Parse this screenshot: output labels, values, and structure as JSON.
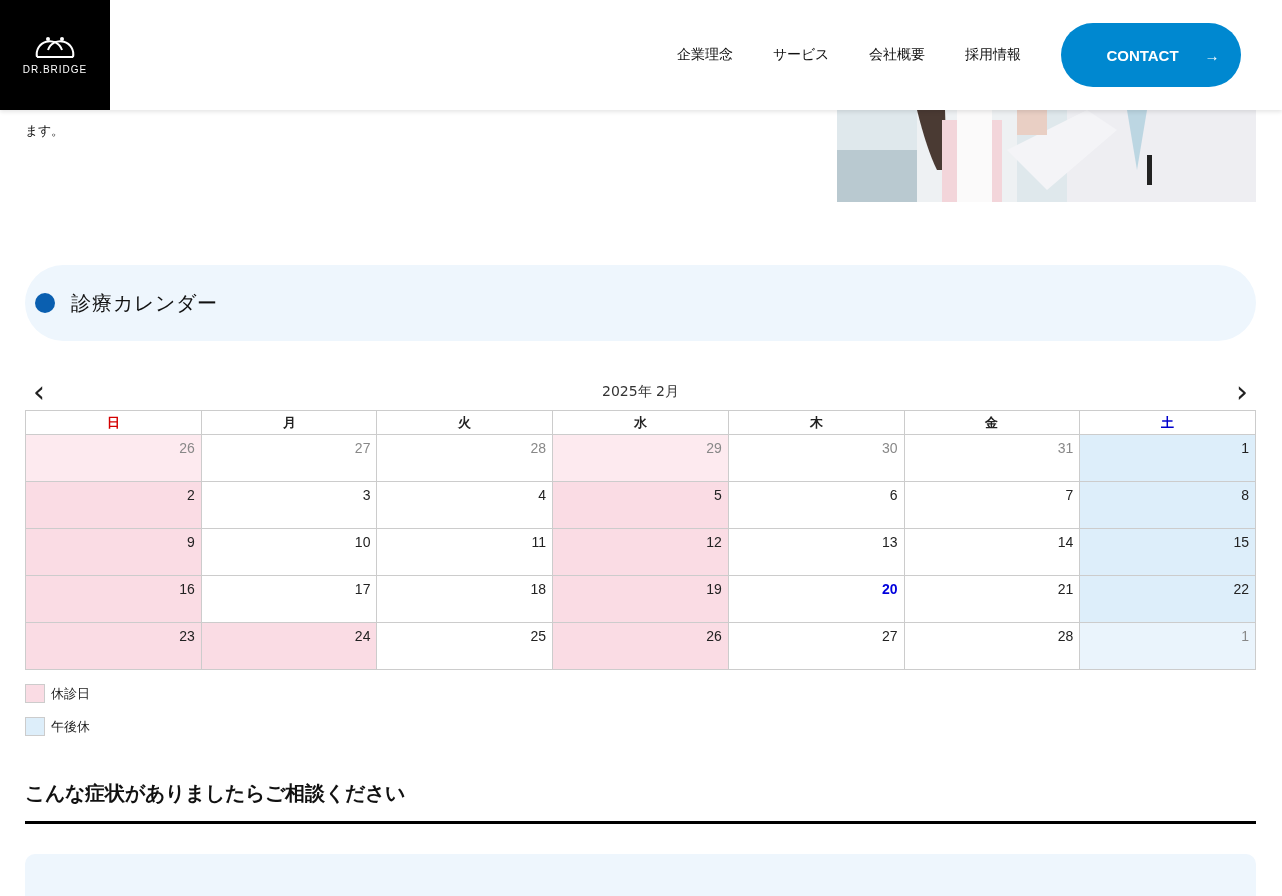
{
  "header": {
    "logo": "DR.BRIDGE",
    "nav": [
      "企業理念",
      "サービス",
      "会社概要",
      "採用情報"
    ],
    "contact": "CONTACT",
    "contact_arrow": "→"
  },
  "intro": {
    "text": "ます。"
  },
  "calendar_section": {
    "title": "診療カレンダー",
    "prev": "‹",
    "month": "2025年 2月",
    "next": "›",
    "weekdays": [
      {
        "label": "日",
        "kind": "sun"
      },
      {
        "label": "月",
        "kind": "day"
      },
      {
        "label": "火",
        "kind": "day"
      },
      {
        "label": "水",
        "kind": "day"
      },
      {
        "label": "木",
        "kind": "day"
      },
      {
        "label": "金",
        "kind": "day"
      },
      {
        "label": "土",
        "kind": "sat"
      }
    ],
    "weeks": [
      [
        {
          "day": "26",
          "kind": "closed",
          "outside": true,
          "today": false
        },
        {
          "day": "27",
          "kind": "open",
          "outside": true,
          "today": false
        },
        {
          "day": "28",
          "kind": "open",
          "outside": true,
          "today": false
        },
        {
          "day": "29",
          "kind": "closed",
          "outside": true,
          "today": false
        },
        {
          "day": "30",
          "kind": "open",
          "outside": true,
          "today": false
        },
        {
          "day": "31",
          "kind": "open",
          "outside": true,
          "today": false
        },
        {
          "day": "1",
          "kind": "half",
          "outside": false,
          "today": false
        }
      ],
      [
        {
          "day": "2",
          "kind": "closed",
          "outside": false,
          "today": false
        },
        {
          "day": "3",
          "kind": "open",
          "outside": false,
          "today": false
        },
        {
          "day": "4",
          "kind": "open",
          "outside": false,
          "today": false
        },
        {
          "day": "5",
          "kind": "closed",
          "outside": false,
          "today": false
        },
        {
          "day": "6",
          "kind": "open",
          "outside": false,
          "today": false
        },
        {
          "day": "7",
          "kind": "open",
          "outside": false,
          "today": false
        },
        {
          "day": "8",
          "kind": "half",
          "outside": false,
          "today": false
        }
      ],
      [
        {
          "day": "9",
          "kind": "closed",
          "outside": false,
          "today": false
        },
        {
          "day": "10",
          "kind": "open",
          "outside": false,
          "today": false
        },
        {
          "day": "11",
          "kind": "open",
          "outside": false,
          "today": false
        },
        {
          "day": "12",
          "kind": "closed",
          "outside": false,
          "today": false
        },
        {
          "day": "13",
          "kind": "open",
          "outside": false,
          "today": false
        },
        {
          "day": "14",
          "kind": "open",
          "outside": false,
          "today": false
        },
        {
          "day": "15",
          "kind": "half",
          "outside": false,
          "today": false
        }
      ],
      [
        {
          "day": "16",
          "kind": "closed",
          "outside": false,
          "today": false
        },
        {
          "day": "17",
          "kind": "open",
          "outside": false,
          "today": false
        },
        {
          "day": "18",
          "kind": "open",
          "outside": false,
          "today": false
        },
        {
          "day": "19",
          "kind": "closed",
          "outside": false,
          "today": false
        },
        {
          "day": "20",
          "kind": "open",
          "outside": false,
          "today": true
        },
        {
          "day": "21",
          "kind": "open",
          "outside": false,
          "today": false
        },
        {
          "day": "22",
          "kind": "half",
          "outside": false,
          "today": false
        }
      ],
      [
        {
          "day": "23",
          "kind": "closed",
          "outside": false,
          "today": false
        },
        {
          "day": "24",
          "kind": "closed",
          "outside": false,
          "today": false
        },
        {
          "day": "25",
          "kind": "open",
          "outside": false,
          "today": false
        },
        {
          "day": "26",
          "kind": "closed",
          "outside": false,
          "today": false
        },
        {
          "day": "27",
          "kind": "open",
          "outside": false,
          "today": false
        },
        {
          "day": "28",
          "kind": "open",
          "outside": false,
          "today": false
        },
        {
          "day": "1",
          "kind": "half",
          "outside": true,
          "today": false
        }
      ]
    ],
    "legend": [
      {
        "label": "休診日",
        "color": "#fadce4"
      },
      {
        "label": "午後休",
        "color": "#ddeefa"
      }
    ]
  },
  "symptoms": {
    "title": "こんな症状がありましたらご相談ください"
  }
}
